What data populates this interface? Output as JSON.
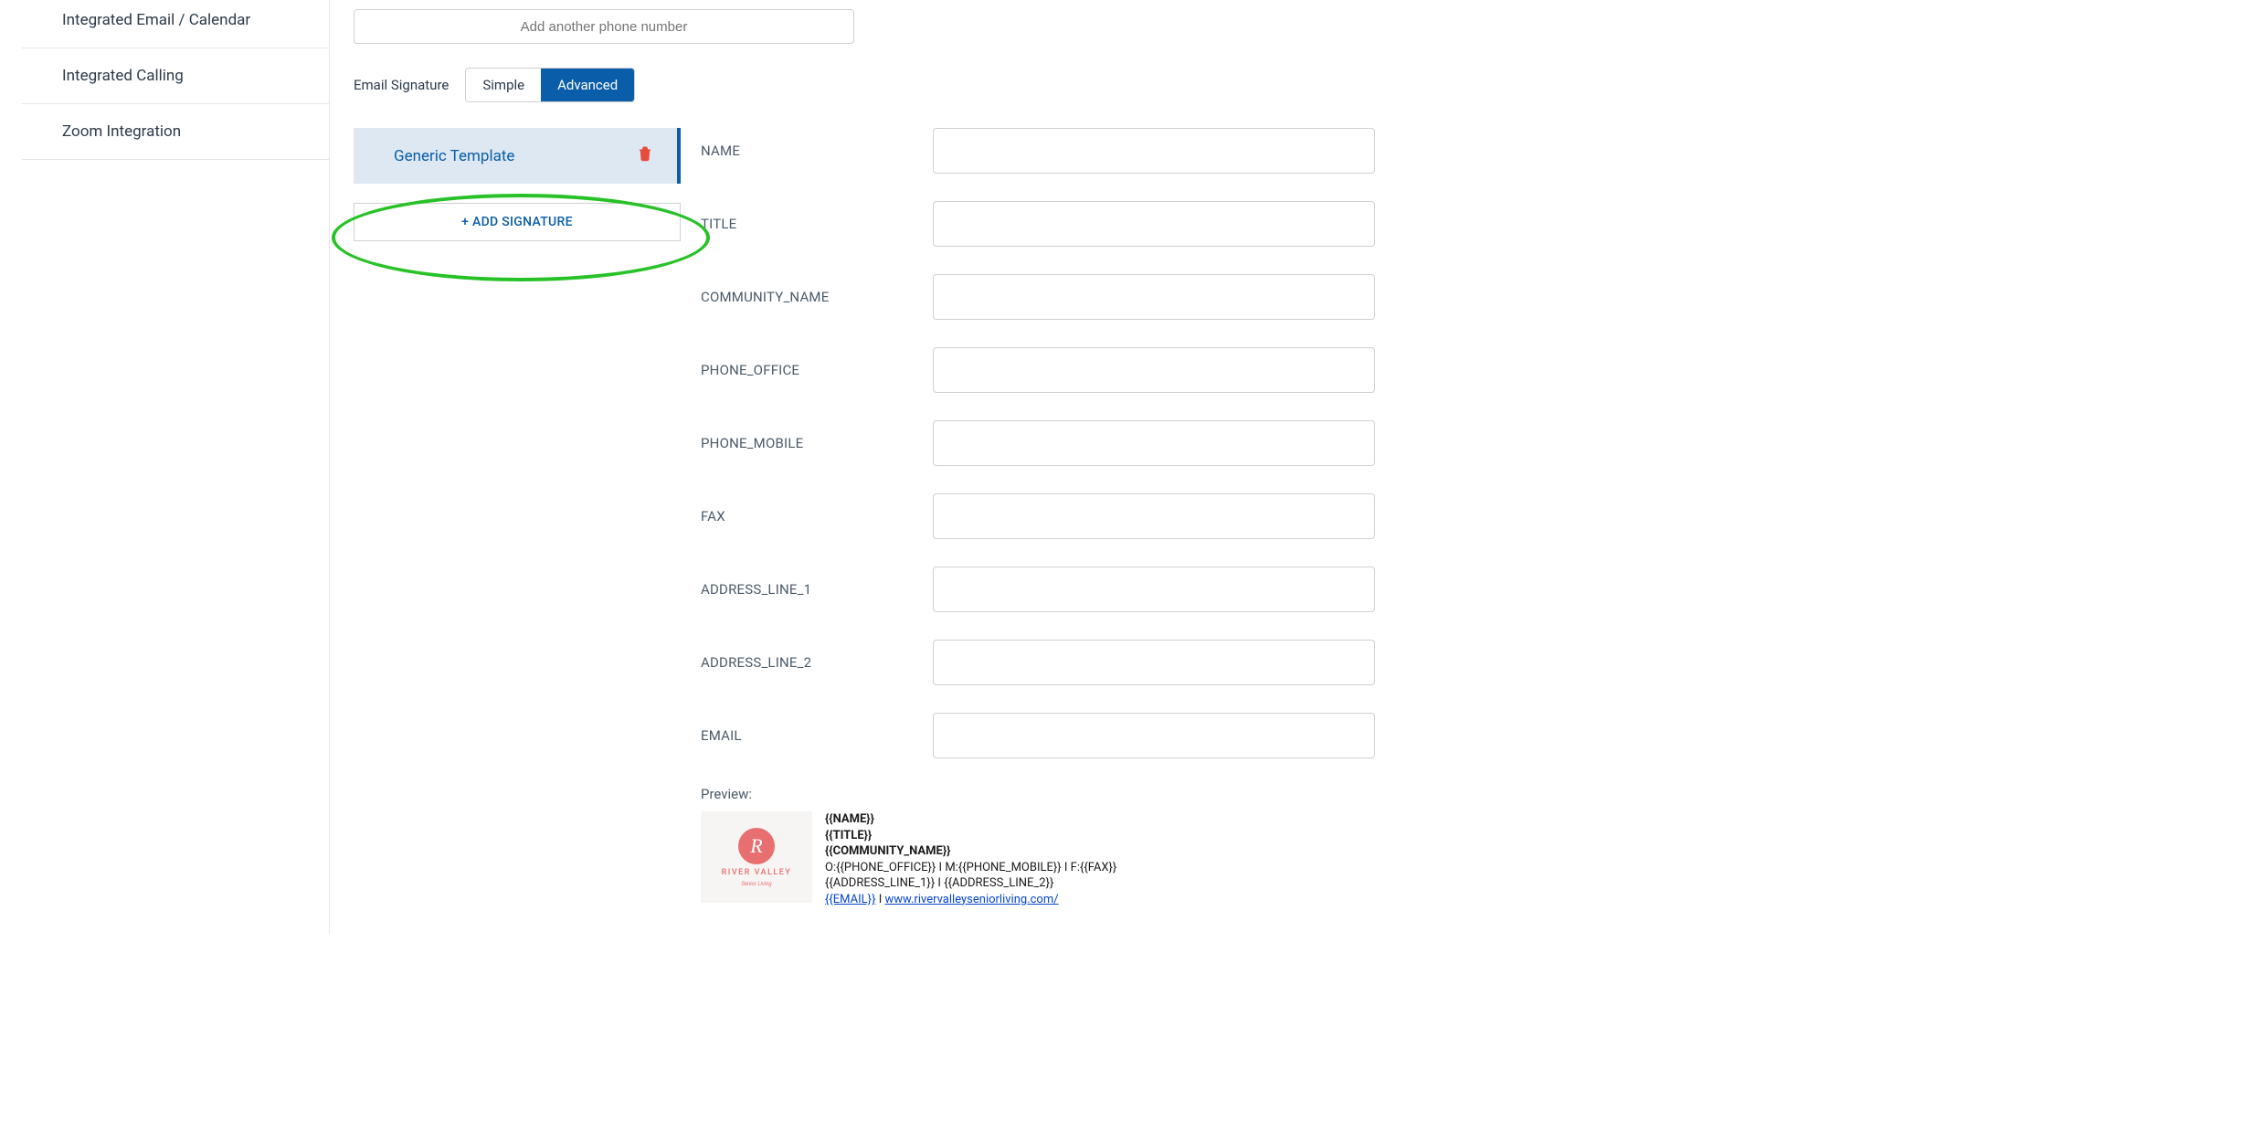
{
  "sidebar": {
    "items": [
      {
        "label": "Integrated Email / Calendar"
      },
      {
        "label": "Integrated Calling"
      },
      {
        "label": "Zoom Integration"
      }
    ]
  },
  "phone": {
    "placeholder": "Add another phone number"
  },
  "signature": {
    "label": "Email Signature",
    "tabs": {
      "simple": "Simple",
      "advanced": "Advanced"
    },
    "template_name": "Generic Template",
    "add_button": "+ ADD SIGNATURE"
  },
  "fields": [
    {
      "key": "name",
      "label": "NAME"
    },
    {
      "key": "title_field",
      "label": "TITLE"
    },
    {
      "key": "community_name",
      "label": "COMMUNITY_NAME"
    },
    {
      "key": "phone_office",
      "label": "PHONE_OFFICE"
    },
    {
      "key": "phone_mobile",
      "label": "PHONE_MOBILE"
    },
    {
      "key": "fax",
      "label": "FAX"
    },
    {
      "key": "address_line_1",
      "label": "ADDRESS_LINE_1"
    },
    {
      "key": "address_line_2",
      "label": "ADDRESS_LINE_2"
    },
    {
      "key": "email",
      "label": "EMAIL"
    }
  ],
  "preview": {
    "label": "Preview:",
    "logo": {
      "letter": "R",
      "brand": "RIVER VALLEY",
      "tagline": "Senior Living"
    },
    "lines": {
      "name": "{{NAME}}",
      "title": "{{TITLE}}",
      "community": "{{COMMUNITY_NAME}}",
      "phones": "O:{{PHONE_OFFICE}} I M:{{PHONE_MOBILE}} I F:{{FAX}}",
      "address": "{{ADDRESS_LINE_1}} I {{ADDRESS_LINE_2}}",
      "email_token": "{{EMAIL}}",
      "sep": " I ",
      "url": "www.rivervalleyseniorliving.com/"
    }
  }
}
